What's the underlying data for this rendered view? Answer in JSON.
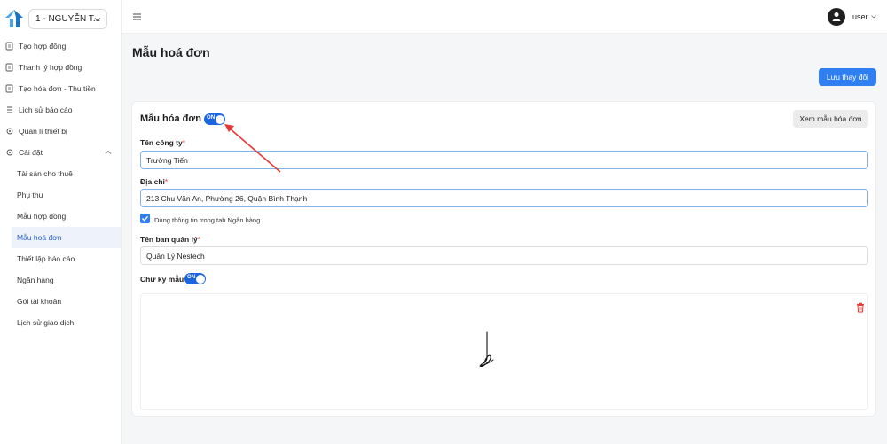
{
  "sidebar": {
    "branch": "1 - NGUYỄN T...",
    "items": [
      {
        "label": "Tạo hợp đồng",
        "icon": "contract-icon"
      },
      {
        "label": "Thanh lý hợp đồng",
        "icon": "contract-icon"
      },
      {
        "label": "Tạo hóa đơn - Thu tiền",
        "icon": "contract-icon"
      },
      {
        "label": "Lịch sử báo cáo",
        "icon": "list-icon"
      },
      {
        "label": "Quản lí thiết bị",
        "icon": "gear-icon"
      },
      {
        "label": "Cài đặt",
        "icon": "gear-icon"
      }
    ],
    "settings_sub": [
      {
        "label": "Tài sản cho thuê"
      },
      {
        "label": "Phụ thu"
      },
      {
        "label": "Mẫu hợp đồng"
      },
      {
        "label": "Mẫu hoá đơn"
      },
      {
        "label": "Thiết lập báo cáo"
      },
      {
        "label": "Ngân hàng"
      },
      {
        "label": "Gói tài khoản"
      },
      {
        "label": "Lịch sử giao dịch"
      }
    ],
    "active_sub": "Mẫu hoá đơn"
  },
  "header": {
    "user_name": "user"
  },
  "main": {
    "page_title": "Mẫu hoá đơn",
    "save_label": "Lưu thay đổi",
    "card": {
      "title": "Mẫu hóa đơn",
      "toggle_label": "ON",
      "preview_label": "Xem mẫu hóa đơn",
      "company_label": "Tên công ty",
      "company_value": "Trường Tiến",
      "address_label": "Địa chỉ",
      "address_value": "213 Chu Văn An, Phường 26, Quận Bình Thạnh",
      "use_bank_label": "Dùng thông tin trong tab Ngân hàng",
      "manager_label": "Tên ban quản lý",
      "manager_value": "Quản Lý Nestech",
      "signature_label": "Chữ ký mẫu",
      "signature_toggle_label": "ON",
      "required_mark": "*"
    }
  },
  "colors": {
    "primary": "#2f7ff0",
    "toggle": "#1b66e0",
    "required": "#e53935",
    "annotation_arrow": "#e53935"
  }
}
